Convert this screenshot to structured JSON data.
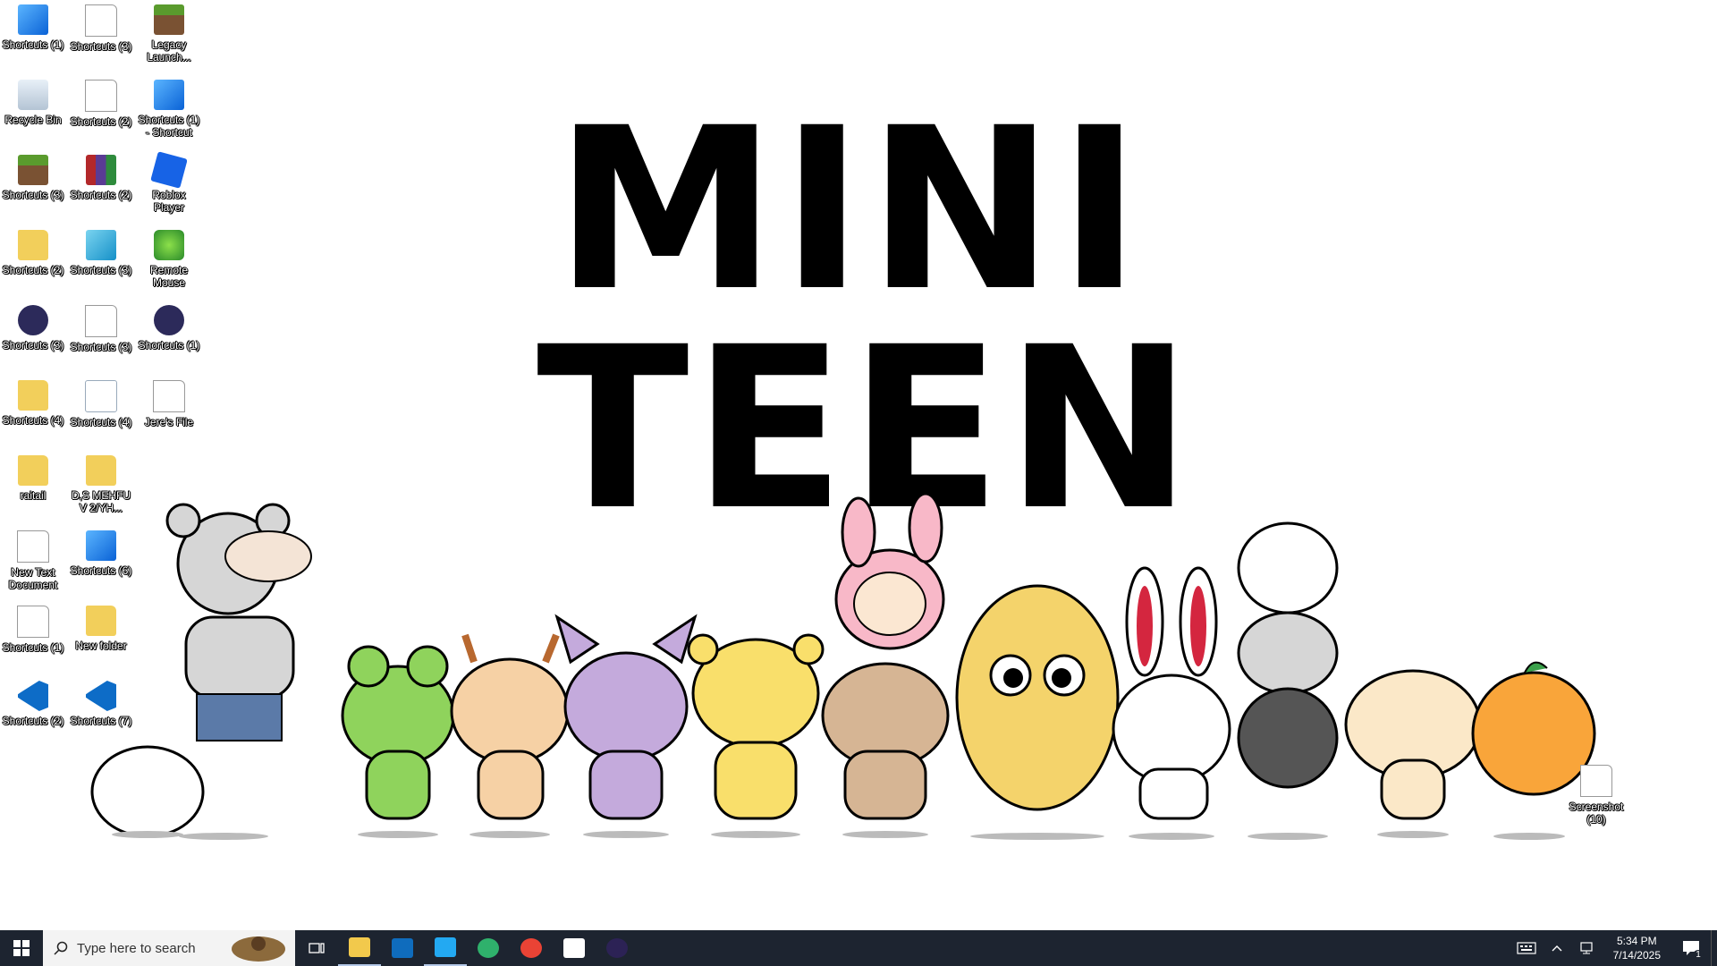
{
  "wallpaper": {
    "title_line1": "MINI",
    "title_line2": "TEEN"
  },
  "desktop_icons": [
    {
      "label": "Shortcuts (1)",
      "icon": "shortcut-win"
    },
    {
      "label": "Shortcuts (3)",
      "icon": "doc"
    },
    {
      "label": "Legacy Launch...",
      "icon": "mc"
    },
    {
      "label": "Recycle Bin",
      "icon": "bin"
    },
    {
      "label": "Shortcuts (2)",
      "icon": "doc"
    },
    {
      "label": "Shortcuts (1) - Shortcut",
      "icon": "shortcut-win"
    },
    {
      "label": "Shortcuts (3)",
      "icon": "mc"
    },
    {
      "label": "Shortcuts (2)",
      "icon": "rar"
    },
    {
      "label": "Roblox Player",
      "icon": "roblox"
    },
    {
      "label": "Shortcuts (2)",
      "icon": "folder"
    },
    {
      "label": "Shortcuts (3)",
      "icon": "cube"
    },
    {
      "label": "Remote Mouse",
      "icon": "remote"
    },
    {
      "label": "Shortcuts (3)",
      "icon": "dark"
    },
    {
      "label": "Shortcuts (3)",
      "icon": "doc"
    },
    {
      "label": "Shortcuts (1)",
      "icon": "dark"
    },
    {
      "label": "Shortcuts (4)",
      "icon": "folder"
    },
    {
      "label": "Shortcuts (4)",
      "icon": "java"
    },
    {
      "label": "Jere's File",
      "icon": "doc"
    },
    {
      "label": "raitail",
      "icon": "folder"
    },
    {
      "label": "D,S MEHFU V 2/YH...",
      "icon": "folder"
    },
    {
      "label": "New Text Document",
      "icon": "doc"
    },
    {
      "label": "Shortcuts (6)",
      "icon": "shortcut-win"
    },
    {
      "label": "Shortcuts (1)",
      "icon": "doc"
    },
    {
      "label": "New folder",
      "icon": "folder"
    },
    {
      "label": "Shortcuts (2)",
      "icon": "vscode"
    },
    {
      "label": "Shortcuts (7)",
      "icon": "vscode"
    },
    {
      "label": "Screenshot (10)",
      "icon": "doc"
    }
  ],
  "taskbar": {
    "search_placeholder": "Type here to search",
    "apps": [
      {
        "name": "File Explorer",
        "icon": "folder-icon",
        "color": "#f2c94c"
      },
      {
        "name": "Outlook",
        "icon": "outlook-icon",
        "color": "#0f6cbd"
      },
      {
        "name": "Visual Studio Code",
        "icon": "vscode-icon",
        "color": "#23a9f2"
      },
      {
        "name": "Microsoft Edge",
        "icon": "edge-icon",
        "color": "#2fb16c"
      },
      {
        "name": "Google Chrome",
        "icon": "chrome-icon",
        "color": "#ea4335"
      },
      {
        "name": "Microsoft Store",
        "icon": "store-icon",
        "color": "#ffffff"
      },
      {
        "name": "Eclipse",
        "icon": "eclipse-icon",
        "color": "#2c2255"
      }
    ],
    "time": "5:34 PM",
    "date": "7/14/2025",
    "notification_count": "1"
  },
  "colors": {
    "taskbar_bg": "#1d2430",
    "accent": "#0078d4"
  }
}
